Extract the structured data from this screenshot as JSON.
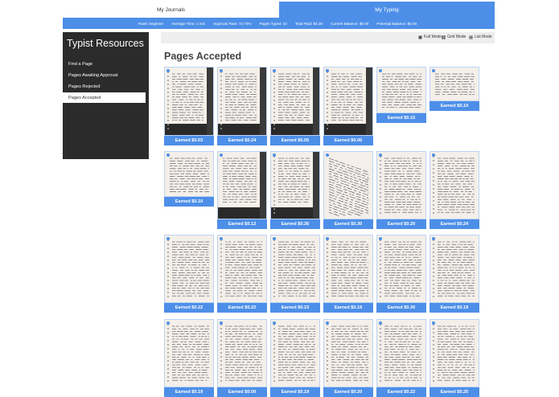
{
  "topnav": {
    "journals_label": "My Journals",
    "typing_label": "My Typing"
  },
  "stats": [
    "Rank: beginner",
    "Average Time: 1 min",
    "Approval Rate: 72.73%",
    "Pages Typed: 33",
    "Total Paid: $4.30",
    "Current Balance: $0.00",
    "Potential Balance: $0.00"
  ],
  "sidebar": {
    "title": "Typist Resources",
    "items": [
      {
        "label": "Find a Page",
        "active": false
      },
      {
        "label": "Pages Awaiting Approval",
        "active": false
      },
      {
        "label": "Pages Rejected",
        "active": false
      },
      {
        "label": "Pages Accepted",
        "active": true
      }
    ]
  },
  "modes": {
    "full": "Full Mode",
    "grid": "Grid Mode",
    "list": "List Mode"
  },
  "page_title": "Pages Accepted",
  "cards": [
    {
      "label": "Earned $0.03",
      "style": "notebook-dark"
    },
    {
      "label": "Earned $0.24",
      "style": "notebook-dark"
    },
    {
      "label": "Earned $0.05",
      "style": "notebook-dark"
    },
    {
      "label": "Earned $0.06",
      "style": "notebook-dark"
    },
    {
      "label": "Earned $0.15",
      "style": "note-short"
    },
    {
      "label": "Earned $0.10",
      "style": "note-short"
    },
    {
      "label": "Earned $0.10",
      "style": "note-short"
    },
    {
      "label": "Earned $0.12",
      "style": "paper-dark"
    },
    {
      "label": "Earned $0.36",
      "style": "notebook-dark"
    },
    {
      "label": "Earned $0.30",
      "style": "paper-slant"
    },
    {
      "label": "Earned $0.20",
      "style": "notebook"
    },
    {
      "label": "Earned $0.24",
      "style": "notebook"
    },
    {
      "label": "Earned $0.22",
      "style": "notebook"
    },
    {
      "label": "Earned $0.22",
      "style": "notebook"
    },
    {
      "label": "Earned $0.23",
      "style": "notebook"
    },
    {
      "label": "Earned $0.19",
      "style": "notebook"
    },
    {
      "label": "Earned $0.30",
      "style": "notebook"
    },
    {
      "label": "Earned $0.19",
      "style": "notebook"
    },
    {
      "label": "Earned $0.19",
      "style": "notebook"
    },
    {
      "label": "Earned $0.00",
      "style": "notebook"
    },
    {
      "label": "Earned $0.19",
      "style": "notebook"
    },
    {
      "label": "Earned $0.20",
      "style": "notebook"
    },
    {
      "label": "Earned $0.22",
      "style": "notebook"
    },
    {
      "label": "Earned $0.25",
      "style": "notebook"
    }
  ],
  "colors": {
    "accent": "#4d8fe8",
    "sidebar_bg": "#2b2b2b",
    "modebar_bg": "#eeeeee"
  },
  "icons": {
    "full": "square-icon",
    "grid": "grid-icon",
    "list": "list-icon"
  }
}
